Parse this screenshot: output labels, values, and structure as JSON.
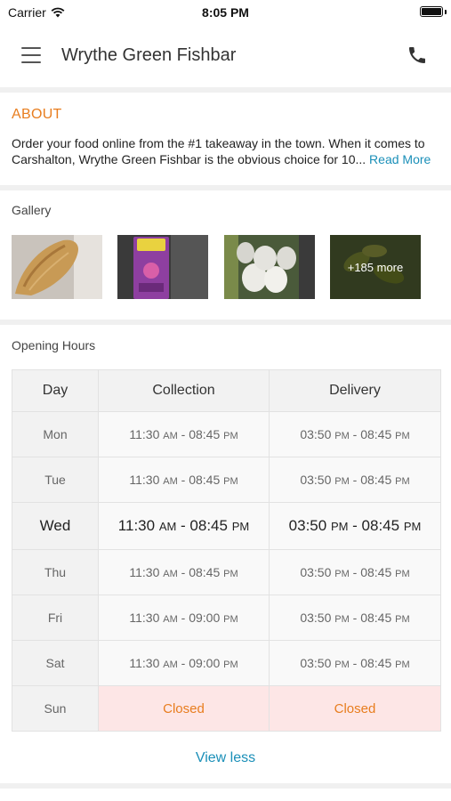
{
  "status_bar": {
    "carrier": "Carrier",
    "time": "8:05 PM"
  },
  "header": {
    "title": "Wrythe Green Fishbar",
    "menu_icon": "hamburger-icon",
    "phone_icon": "phone-icon"
  },
  "about": {
    "heading": "ABOUT",
    "text": "Order your food online from the #1 takeaway in the town. When it comes to Carshalton, Wrythe Green Fishbar is the obvious choice for 10...",
    "read_more": "Read More"
  },
  "gallery": {
    "label": "Gallery",
    "more_label": "+185 more"
  },
  "opening_hours": {
    "label": "Opening Hours",
    "columns": [
      "Day",
      "Collection",
      "Delivery"
    ],
    "rows": [
      {
        "day": "Mon",
        "collection": {
          "from": "11:30",
          "from_p": "AM",
          "to": "08:45",
          "to_p": "PM"
        },
        "delivery": {
          "from": "03:50",
          "from_p": "PM",
          "to": "08:45",
          "to_p": "PM"
        }
      },
      {
        "day": "Tue",
        "collection": {
          "from": "11:30",
          "from_p": "AM",
          "to": "08:45",
          "to_p": "PM"
        },
        "delivery": {
          "from": "03:50",
          "from_p": "PM",
          "to": "08:45",
          "to_p": "PM"
        }
      },
      {
        "day": "Wed",
        "collection": {
          "from": "11:30",
          "from_p": "AM",
          "to": "08:45",
          "to_p": "PM"
        },
        "delivery": {
          "from": "03:50",
          "from_p": "PM",
          "to": "08:45",
          "to_p": "PM"
        }
      },
      {
        "day": "Thu",
        "collection": {
          "from": "11:30",
          "from_p": "AM",
          "to": "08:45",
          "to_p": "PM"
        },
        "delivery": {
          "from": "03:50",
          "from_p": "PM",
          "to": "08:45",
          "to_p": "PM"
        }
      },
      {
        "day": "Fri",
        "collection": {
          "from": "11:30",
          "from_p": "AM",
          "to": "09:00",
          "to_p": "PM"
        },
        "delivery": {
          "from": "03:50",
          "from_p": "PM",
          "to": "08:45",
          "to_p": "PM"
        }
      },
      {
        "day": "Sat",
        "collection": {
          "from": "11:30",
          "from_p": "AM",
          "to": "09:00",
          "to_p": "PM"
        },
        "delivery": {
          "from": "03:50",
          "from_p": "PM",
          "to": "08:45",
          "to_p": "PM"
        }
      },
      {
        "day": "Sun",
        "collection_closed": "Closed",
        "delivery_closed": "Closed"
      }
    ],
    "view_less": "View less"
  },
  "colors": {
    "accent_orange": "#e87d1e",
    "link_blue": "#1a8fb8",
    "closed_bg": "#fde6e6"
  }
}
